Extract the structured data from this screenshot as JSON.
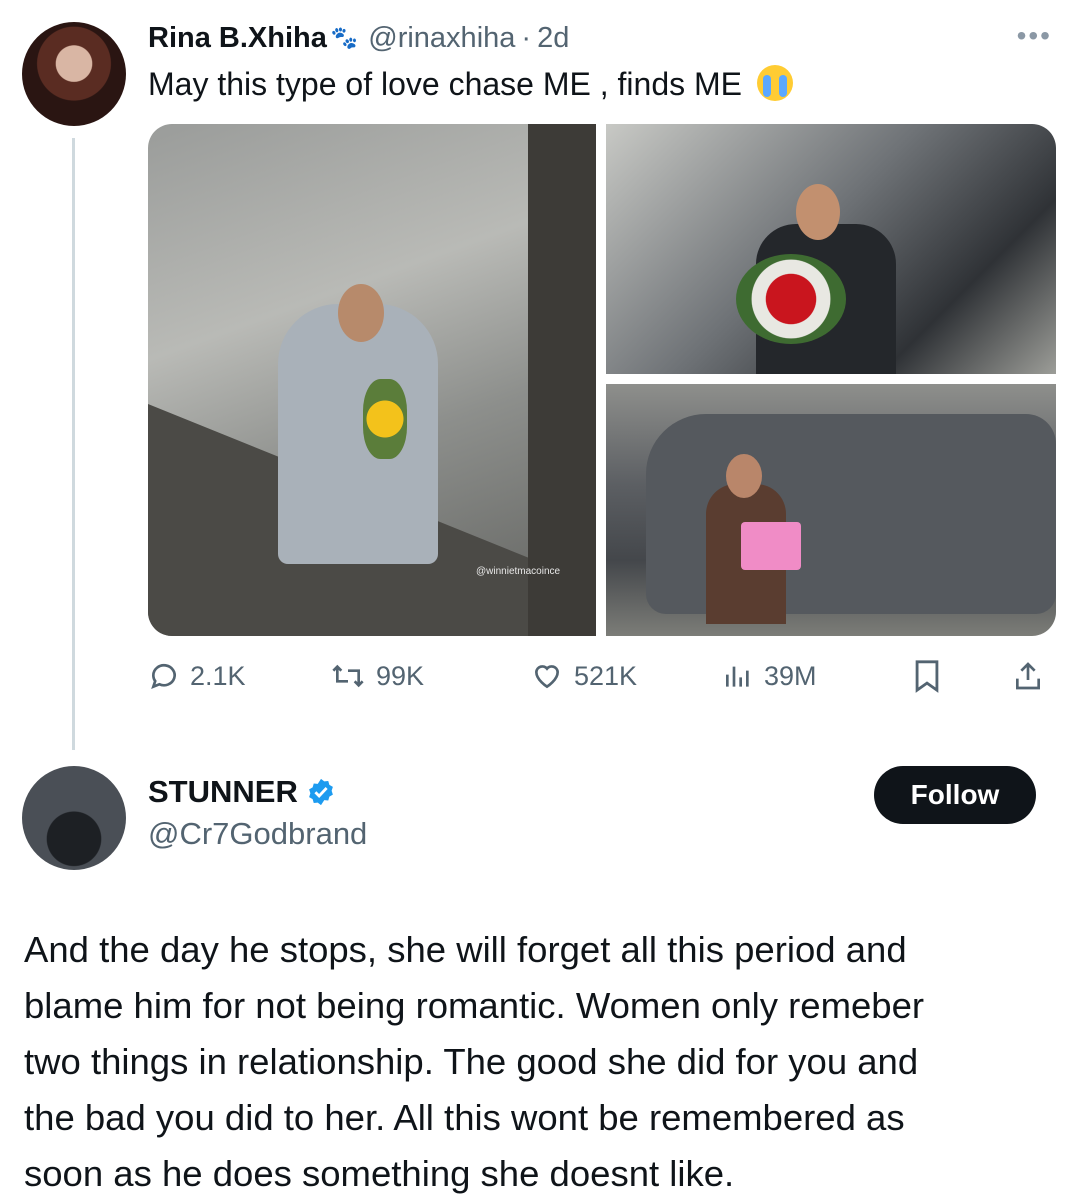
{
  "tweet": {
    "display_name": "Rina B.Xhiha",
    "handle": "@rinaxhiha",
    "separator": "·",
    "time": "2d",
    "text": "May this type of love chase ME , finds ME",
    "watermark": "@winnietmacoince",
    "stats": {
      "replies": "2.1K",
      "retweets": "99K",
      "likes": "521K",
      "views": "39M"
    }
  },
  "reply": {
    "display_name": "STUNNER",
    "handle": "@Cr7Godbrand",
    "follow_label": "Follow",
    "text_lines": [
      "And the day he stops, she will forget all this period and",
      "blame him for not being romantic. Women only remeber",
      "two things in relationship. The good she did for you and",
      "the bad you did to her. All this wont be remembered as",
      "soon as he does something she doesnt like."
    ]
  },
  "colors": {
    "text_primary": "#0f1419",
    "text_secondary": "#536471",
    "verified_blue": "#1d9bf0",
    "follow_bg": "#0f1419"
  },
  "icons": [
    "more-icon",
    "paw-icon",
    "crying-emoji",
    "reply-icon",
    "retweet-icon",
    "like-icon",
    "views-icon",
    "bookmark-icon",
    "share-icon",
    "verified-icon"
  ]
}
